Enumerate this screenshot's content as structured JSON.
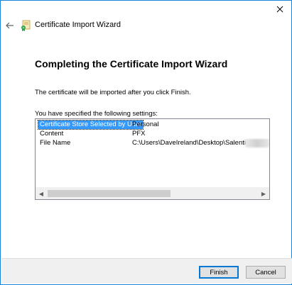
{
  "window": {
    "title": "Certificate Import Wizard",
    "close_glyph": "✕",
    "back_glyph": "←",
    "icon": "certificate-icon"
  },
  "main": {
    "heading": "Completing the Certificate Import Wizard",
    "info": "The certificate will be imported after you click Finish.",
    "settings_label": "You have specified the following settings:",
    "settings": [
      {
        "key": "Certificate Store Selected by User",
        "value": "Personal"
      },
      {
        "key": "Content",
        "value": "PFX"
      },
      {
        "key": "File Name",
        "value": "C:\\Users\\DaveIreland\\Desktop\\Salentica - C"
      }
    ],
    "scroll_left": "◀",
    "scroll_right": "▶"
  },
  "footer": {
    "finish_label": "Finish",
    "cancel_label": "Cancel"
  },
  "colors": {
    "selection": "#3399ff",
    "accent_border": "#1883d7",
    "footer_bg": "#f0f0f0"
  }
}
